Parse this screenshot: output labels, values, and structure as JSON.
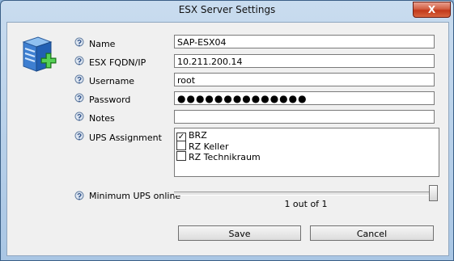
{
  "window": {
    "title": "ESX Server Settings",
    "close_glyph": "X",
    "close_color": "#c8462a"
  },
  "form": {
    "name": {
      "label": "Name",
      "value": "SAP-ESX04",
      "icon": "help-icon"
    },
    "fqdn": {
      "label": "ESX FQDN/IP",
      "value": "10.211.200.14",
      "icon": "help-icon"
    },
    "username": {
      "label": "Username",
      "value": "root",
      "icon": "help-icon"
    },
    "password": {
      "label": "Password",
      "value": "●●●●●●●●●●●●●●",
      "icon": "help-icon"
    },
    "notes": {
      "label": "Notes",
      "value": "",
      "icon": "help-icon"
    },
    "ups": {
      "label": "UPS Assignment",
      "icon": "help-icon",
      "items": [
        {
          "label": "BRZ",
          "checked": true
        },
        {
          "label": "RZ Keller",
          "checked": false
        },
        {
          "label": "RZ Technikraum",
          "checked": false
        }
      ]
    },
    "min_ups": {
      "label": "Minimum UPS online",
      "value_text": "1 out of 1",
      "level": 1.0,
      "icon": "help-icon"
    }
  },
  "buttons": {
    "save": "Save",
    "cancel": "Cancel"
  },
  "icons": {
    "server": "server-add-icon"
  }
}
